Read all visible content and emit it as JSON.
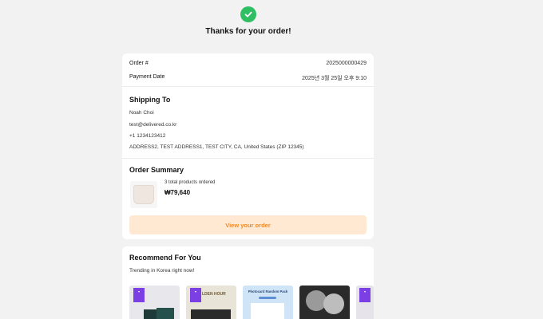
{
  "header": {
    "title": "Thanks for your order!",
    "check_color": "#2fbf62"
  },
  "order": {
    "number_label": "Order #",
    "number_value": "2025000000429",
    "date_label": "Payment Date",
    "date_value": "2025년 3월 25일 오후 9:10"
  },
  "shipping": {
    "title": "Shipping To",
    "name": "Noah Choi",
    "email": "test@delivered.co.kr",
    "phone": "+1 1234123412",
    "address": "ADDRESS2, TEST ADDRESS1, TEST CITY, CA, United States (ZIP 12345)"
  },
  "summary": {
    "title": "Order Summary",
    "count_text": "3 total products ordered",
    "total": "₩79,640",
    "view_button": "View your order",
    "button_bg": "#ffe9d3",
    "button_text_color": "#ef8a2a"
  },
  "recommend": {
    "title": "Recommend For You",
    "subtitle": "Trending in Korea right now!",
    "products": [
      {
        "name": "product-1",
        "badge": true
      },
      {
        "name": "product-2",
        "badge": true,
        "text": "LDEN HOUR"
      },
      {
        "name": "product-3",
        "badge": false,
        "text": "Photocard Random Pack"
      },
      {
        "name": "product-4",
        "badge": false
      },
      {
        "name": "product-5",
        "badge": true
      }
    ]
  }
}
